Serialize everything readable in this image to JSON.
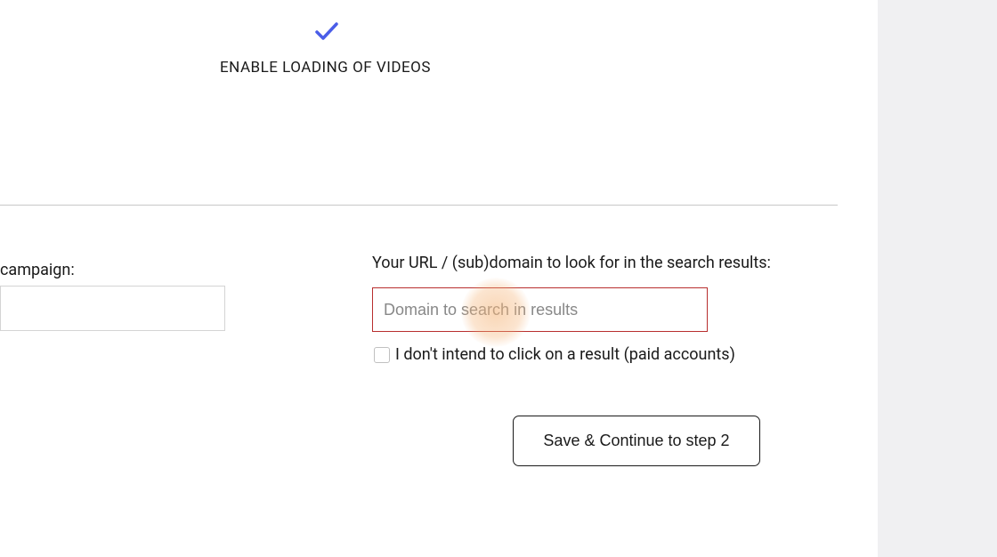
{
  "header": {
    "enable_videos_label": "ENABLE LOADING OF VIDEOS"
  },
  "form": {
    "campaign_label": "campaign:",
    "campaign_value": "",
    "url_label": "Your URL / (sub)domain to look for in the search results:",
    "url_placeholder": "Domain to search in results",
    "url_value": "",
    "no_click_checkbox_label": "I don't intend to click on a result (paid accounts)",
    "save_button_label": "Save & Continue to step 2"
  }
}
